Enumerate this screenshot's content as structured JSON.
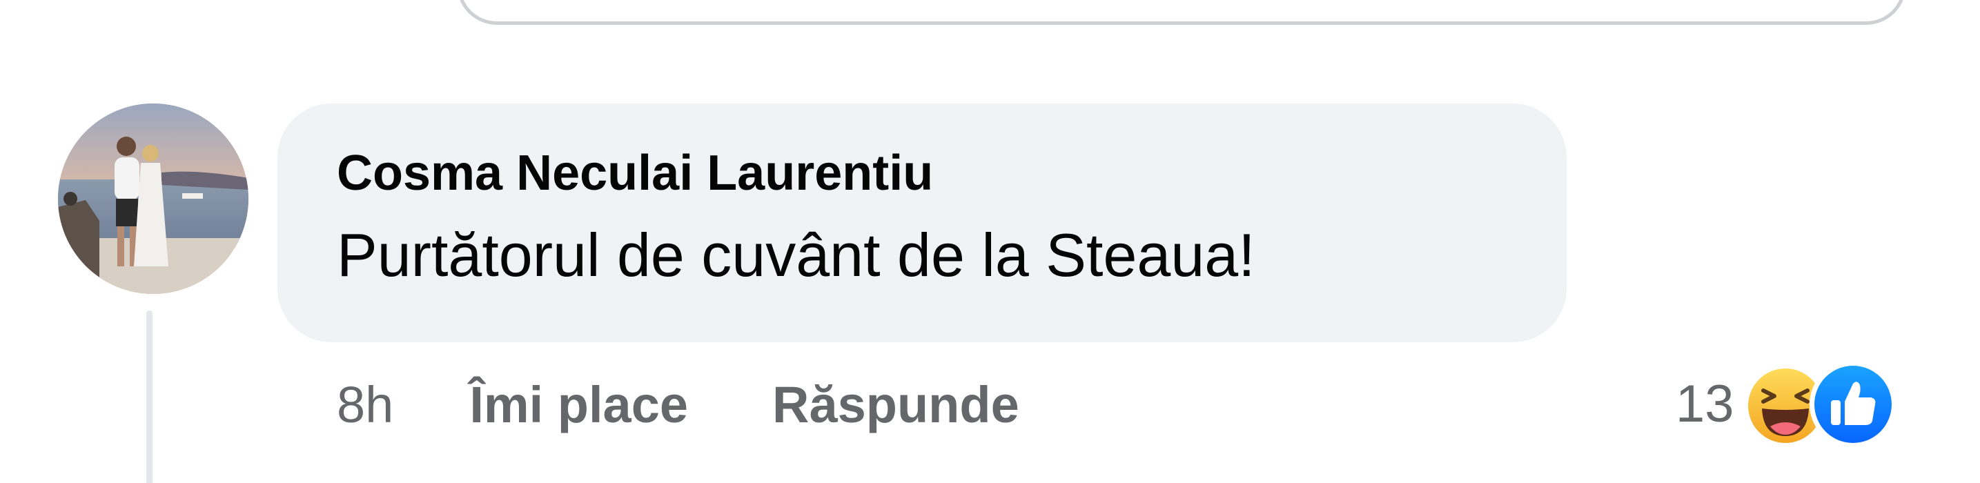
{
  "comment": {
    "author": "Cosma Neculai Laurentiu",
    "text": "Purtătorul de cuvânt de la Steaua!",
    "timestamp": "8h",
    "like_label": "Îmi place",
    "reply_label": "Răspunde",
    "reaction_count": "13",
    "reactions": [
      "haha-icon",
      "like-icon"
    ]
  },
  "colors": {
    "bubble": "#f0f2f5",
    "text": "#050505",
    "secondary_text": "#65676b",
    "like_blue": "#1877f2",
    "haha_yellow": "#fcc63e"
  }
}
